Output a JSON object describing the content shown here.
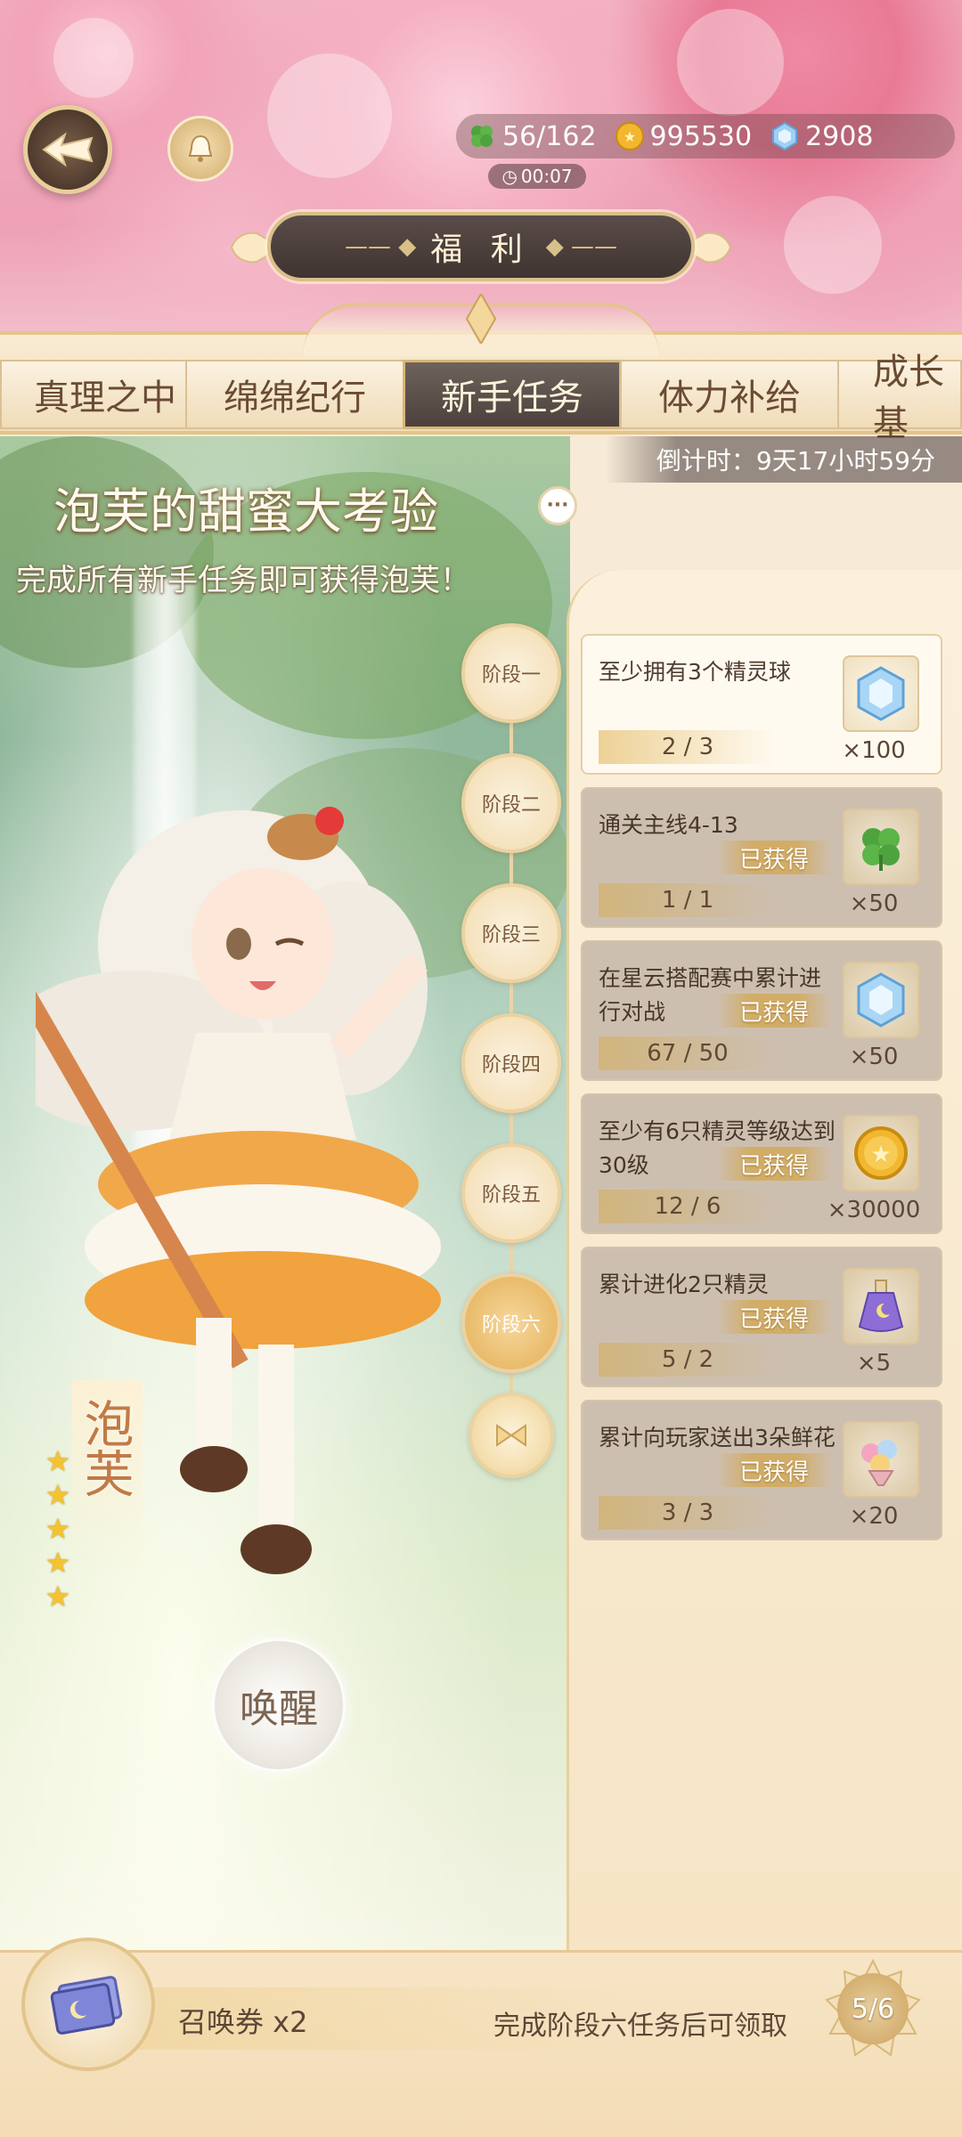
{
  "header": {
    "stamina": "56/162",
    "gold": "995530",
    "crystals": "2908",
    "timer": "00:07",
    "title": "福 利",
    "title_dash_left": "—— ◆",
    "title_dash_right": "◆ ——"
  },
  "tabs": [
    {
      "label": "真理之中",
      "active": false
    },
    {
      "label": "绵绵纪行",
      "active": false
    },
    {
      "label": "新手任务",
      "active": true
    },
    {
      "label": "体力补给",
      "active": false
    },
    {
      "label": "成长基",
      "active": false
    }
  ],
  "event": {
    "countdown": "倒计时：9天17小时59分",
    "title": "泡芙的甜蜜大考验",
    "subtitle": "完成所有新手任务即可获得泡芙！",
    "info_glyph": "···",
    "character_name": "泡芙",
    "star_count": 5,
    "star_glyph": "★",
    "awaken_label": "唤醒"
  },
  "stages": [
    {
      "label": "阶段一"
    },
    {
      "label": "阶段二"
    },
    {
      "label": "阶段三"
    },
    {
      "label": "阶段四"
    },
    {
      "label": "阶段五"
    },
    {
      "label": "阶段六",
      "current": true
    }
  ],
  "tasks": [
    {
      "text": "至少拥有3个精灵球",
      "progress": "2 / 3",
      "reward": "×100",
      "reward_icon": "crystal-icon",
      "claimed": false,
      "stamp": ""
    },
    {
      "text": "通关主线4-13",
      "progress": "1 / 1",
      "reward": "×50",
      "reward_icon": "clover-icon",
      "claimed": true,
      "stamp": "已获得"
    },
    {
      "text": "在星云搭配赛中累计进行对战",
      "progress": "67 / 50",
      "reward": "×50",
      "reward_icon": "crystal-icon",
      "claimed": true,
      "stamp": "已获得"
    },
    {
      "text": "至少有6只精灵等级达到30级",
      "progress": "12 / 6",
      "reward": "×30000",
      "reward_icon": "gold-coin-icon",
      "claimed": true,
      "stamp": "已获得"
    },
    {
      "text": "累计进化2只精灵",
      "progress": "5 / 2",
      "reward": "×5",
      "reward_icon": "potion-icon",
      "claimed": true,
      "stamp": "已获得"
    },
    {
      "text": "累计向玩家送出3朵鲜花",
      "progress": "3 / 3",
      "reward": "×20",
      "reward_icon": "flower-bouquet-icon",
      "claimed": true,
      "stamp": "已获得"
    }
  ],
  "bottom": {
    "ticket_label": "召唤券 x2",
    "claim_hint": "完成阶段六任务后可领取",
    "stage_progress": "5/6"
  },
  "colors": {
    "accent_gold": "#e4c48a",
    "tab_active": "#4c413c",
    "claimed_card": "#cdbfb0"
  }
}
